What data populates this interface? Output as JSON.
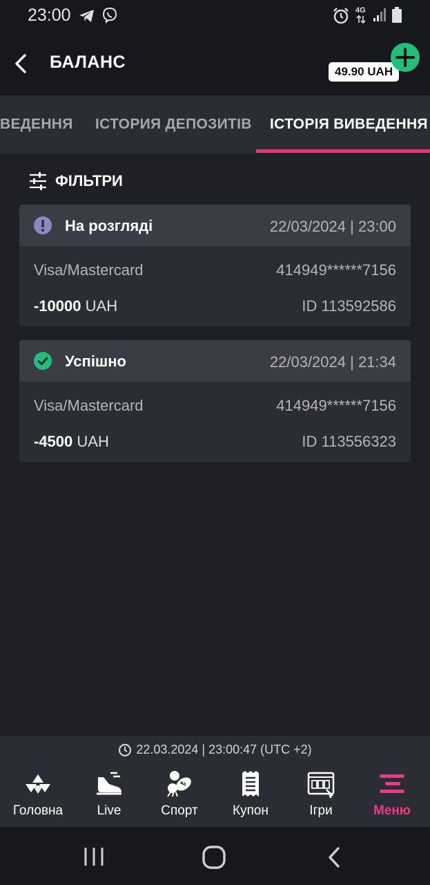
{
  "status_bar": {
    "time": "23:00",
    "network": "4G"
  },
  "header": {
    "title": "БАЛАНС",
    "balance": "49.90 UAH"
  },
  "tabs": [
    {
      "label": "ВЕДЕННЯ",
      "active": false
    },
    {
      "label": "ІСТОРИЯ ДЕПОЗИТІВ",
      "active": false
    },
    {
      "label": "ІСТОРІЯ ВИВЕДЕННЯ",
      "active": true
    }
  ],
  "filters": {
    "label": "ФІЛЬТРИ"
  },
  "transactions": [
    {
      "status": "На розгляді",
      "status_icon": "exclamation-circle-icon",
      "datetime": "22/03/2024 | 23:00",
      "method": "Visa/Mastercard",
      "card": "414949******7156",
      "amount": "-10000",
      "currency": "UAH",
      "id": "ID 113592586"
    },
    {
      "status": "Успішно",
      "status_icon": "check-circle-icon",
      "datetime": "22/03/2024 | 21:34",
      "method": "Visa/Mastercard",
      "card": "414949******7156",
      "amount": "-4500",
      "currency": "UAH",
      "id": "ID 113556323"
    }
  ],
  "server_time": "22.03.2024 | 23:00:47 (UTC +2)",
  "bottom_nav": [
    {
      "label": "Головна",
      "icon": "home-logo-icon",
      "active": false
    },
    {
      "label": "Live",
      "icon": "live-sneaker-icon",
      "active": false
    },
    {
      "label": "Спорт",
      "icon": "sport-balls-icon",
      "active": false
    },
    {
      "label": "Купон",
      "icon": "coupon-receipt-icon",
      "active": false
    },
    {
      "label": "Ігри",
      "icon": "games-slot-icon",
      "active": false
    },
    {
      "label": "Меню",
      "icon": "menu-icon",
      "active": true
    }
  ],
  "colors": {
    "background": "#1e1f27",
    "accent": "#e8337e",
    "success": "#20c07a",
    "pending": "#8b89c2"
  }
}
